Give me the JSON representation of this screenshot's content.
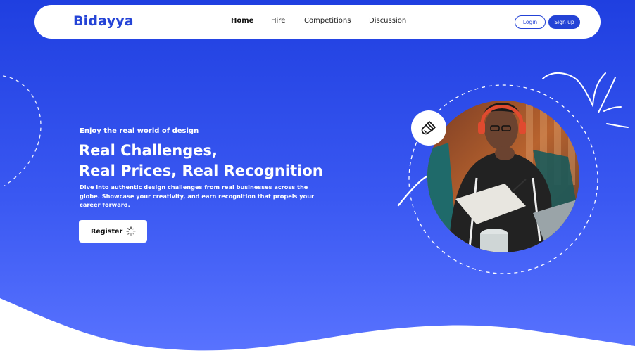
{
  "brand": {
    "name": "Bidayya"
  },
  "nav": {
    "links": [
      {
        "label": "Home",
        "active": true
      },
      {
        "label": "Hire"
      },
      {
        "label": "Competitions"
      },
      {
        "label": "Discussion"
      }
    ],
    "login_label": "Login",
    "signup_label": "Sign up"
  },
  "hero": {
    "eyebrow": "Enjoy the real world of design",
    "headline_line1": "Real Challenges,",
    "headline_line2": "Real Prices, Real Recognition",
    "description": "Dive into authentic design challenges from real businesses across the globe. Showcase your creativity, and earn recognition that propels your career forward.",
    "register_label": "Register"
  },
  "icons": {
    "badge": "paintbrush-icon",
    "register_status": "loading-spinner-icon"
  },
  "colors": {
    "brand": "#2443d6",
    "hero_top": "#1f3fe0",
    "hero_bottom": "#5a74ff"
  }
}
